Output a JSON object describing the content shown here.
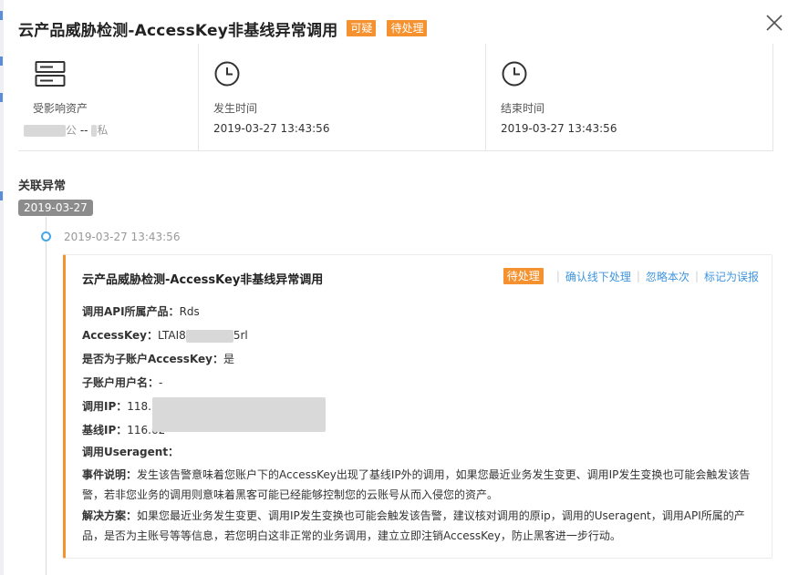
{
  "header": {
    "title": "云产品威胁检测-AccessKey非基线异常调用",
    "tags": [
      "可疑",
      "待处理"
    ]
  },
  "info": {
    "asset": {
      "label": "受影响资产",
      "public_suffix": "公",
      "separator": "--",
      "private_suffix": "私"
    },
    "start": {
      "label": "发生时间",
      "value": "2019-03-27 13:43:56"
    },
    "end": {
      "label": "结束时间",
      "value": "2019-03-27 13:43:56"
    }
  },
  "related": {
    "section_title": "关联异常",
    "date": "2019-03-27",
    "time": "2019-03-27 13:43:56"
  },
  "event": {
    "title": "云产品威胁检测-AccessKey非基线异常调用",
    "status": "待处理",
    "actions": [
      "确认线下处理",
      "忽略本次",
      "标记为误报"
    ],
    "fields": {
      "product_label": "调用API所属产品：",
      "product_value": "Rds",
      "ak_label": "AccessKey：",
      "ak_prefix": "LTAI8",
      "ak_suffix": "5rl",
      "subaccount_label": "是否为子账户AccessKey：",
      "subaccount_value": "是",
      "subuser_label": "子账户用户名：",
      "subuser_value": "-",
      "ip_label": "调用IP：",
      "ip_prefix": "118.31",
      "baseline_label": "基线IP：",
      "baseline_prefix": "116.62",
      "ua_label": "调用Useragent："
    },
    "desc_label": "事件说明：",
    "desc_text": "发生该告警意味着您账户下的AccessKey出现了基线IP外的调用，如果您最近业务发生变更、调用IP发生变换也可能会触发该告警，若非您业务的调用则意味着黑客可能已经能够控制您的云账号从而入侵您的资产。",
    "solution_label": "解决方案：",
    "solution_text": "如果您最近业务发生变更、调用IP发生变换也可能会触发该告警，建议核对调用的原ip，调用的Useragent，调用API所属的产品，是否为主账号等等信息，若您明白这非正常的业务调用，建立立即注销AccessKey，防止黑客进一步行动。"
  },
  "colors": {
    "accent_orange": "#f5922f",
    "link_blue": "#3e94e0",
    "timeline_blue": "#46a7e8",
    "badge_gray": "#8c8c8c"
  },
  "icons": [
    "server-icon",
    "clock-icon",
    "clock-icon",
    "close-icon"
  ]
}
